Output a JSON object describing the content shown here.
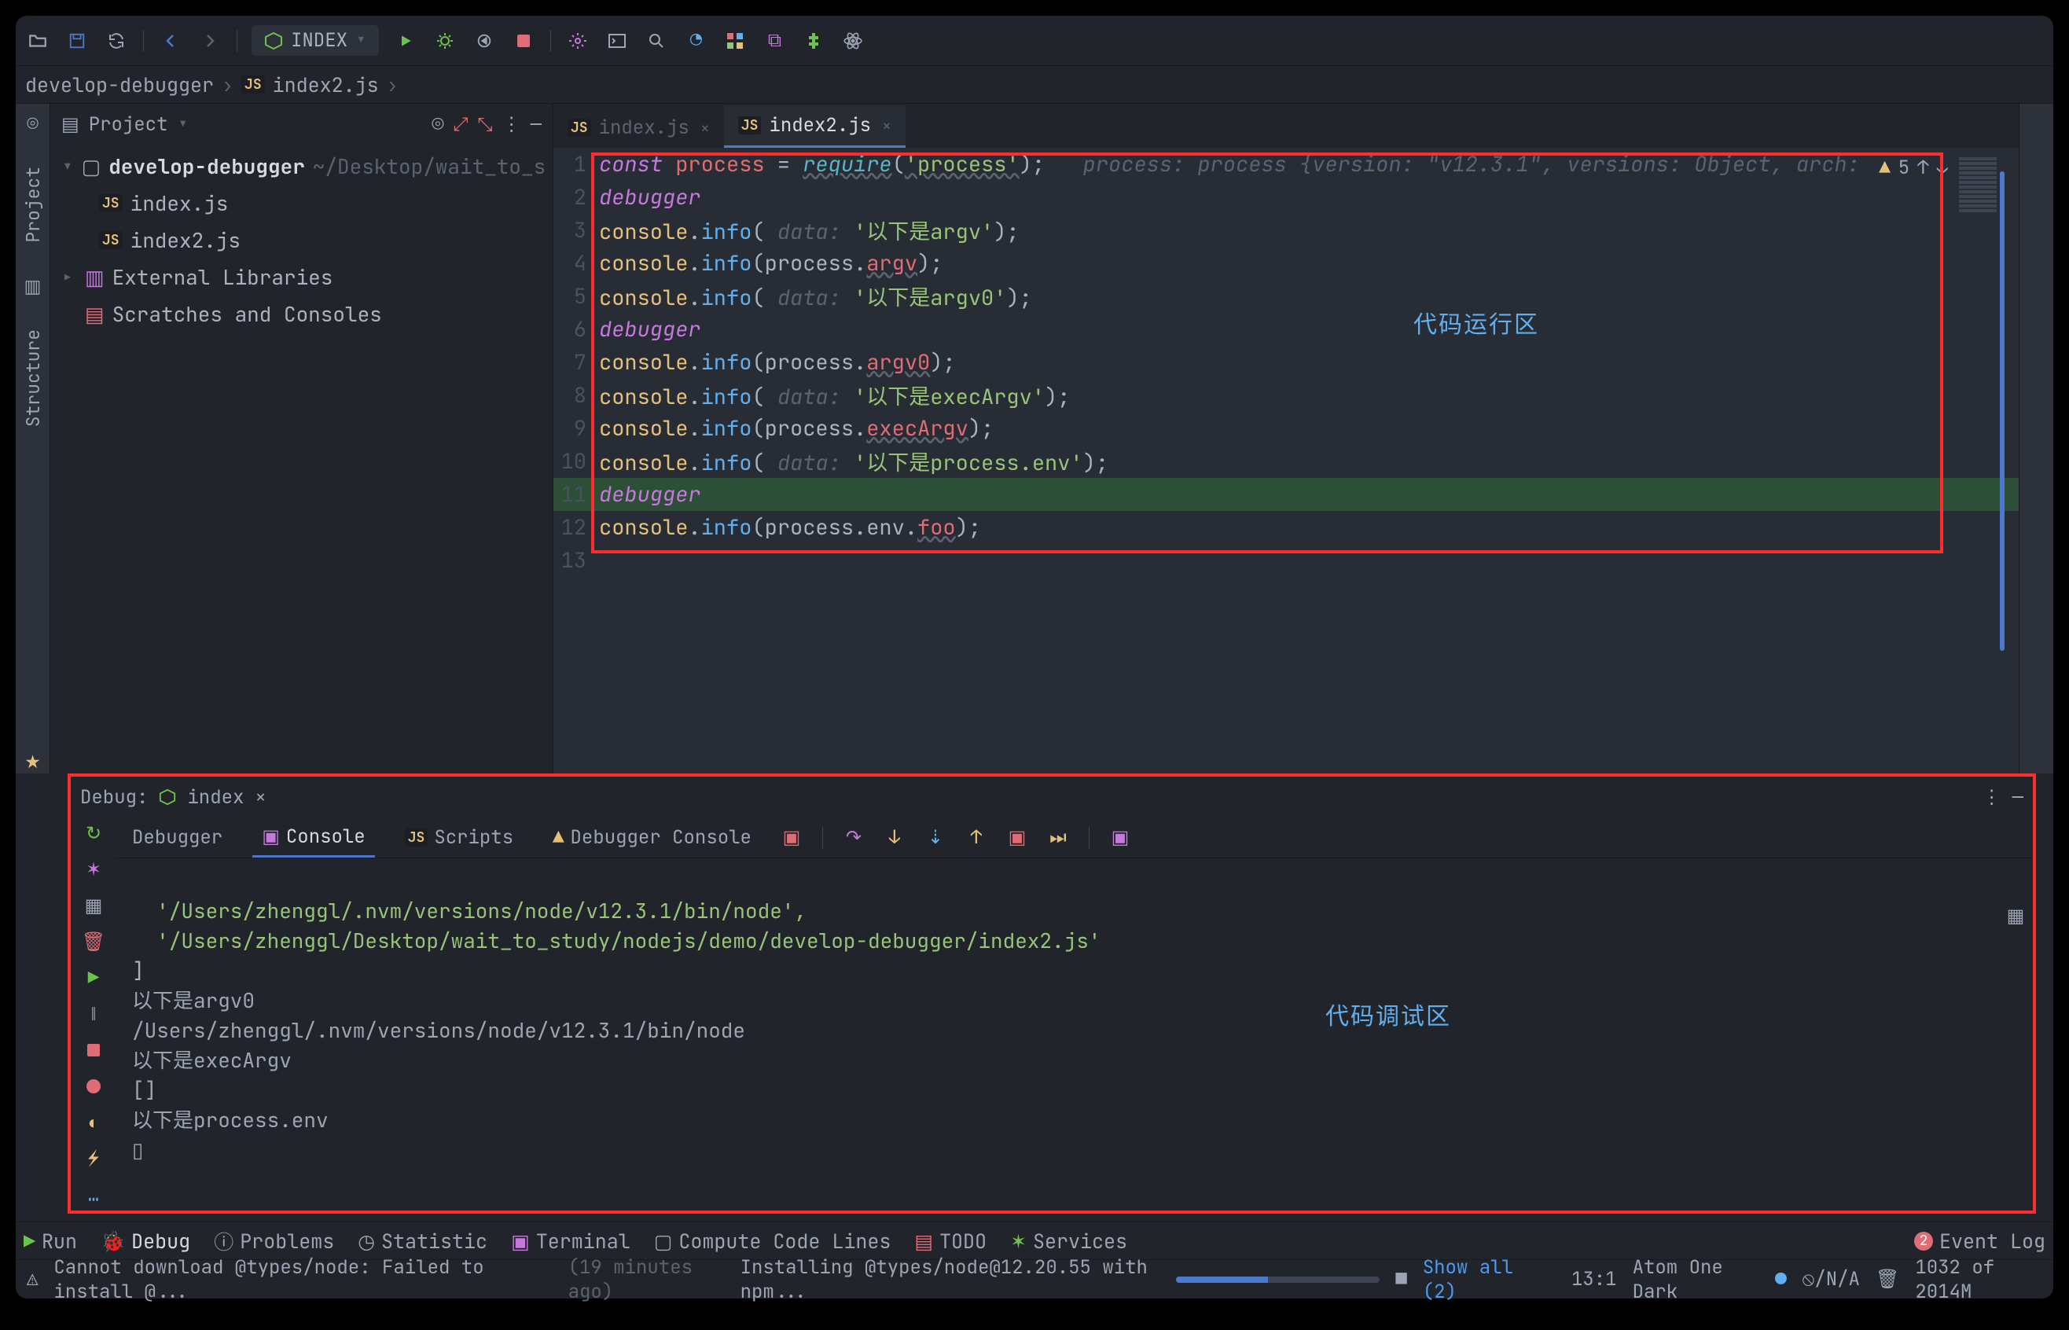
{
  "toolbar": {
    "run_config": "INDEX"
  },
  "breadcrumbs": {
    "project": "develop-debugger",
    "file": "index2.js"
  },
  "project_panel": {
    "title": "Project",
    "root": {
      "name": "develop-debugger",
      "path": "~/Desktop/wait_to_s"
    },
    "files": {
      "f1": "index.js",
      "f2": "index2.js"
    },
    "ext_libs": "External Libraries",
    "scratches": "Scratches and Consoles"
  },
  "left_gutter": {
    "project": "Project",
    "structure": "Structure"
  },
  "right_gutter": {
    "favorites": "Favorites"
  },
  "tabs": {
    "t1": "index.js",
    "t2": "index2.js"
  },
  "inspector": {
    "warn_count": "5"
  },
  "code_area_overlay": "代码运行区",
  "debug_area_overlay": "代码调试区",
  "code": {
    "l1": {
      "pre": "const ",
      "id": "process",
      "mid": " = ",
      "fn": "require",
      "open": "(",
      "str": "'process'",
      "close": ");",
      "hint": "   process: process {version: \"v12.3.1\", versions: Object, arch: "
    },
    "l2": "debugger",
    "l3": {
      "a": "console",
      "b": ".",
      "c": "info",
      "d": "( ",
      "hl": "data: ",
      "s": "'以下是argv'",
      "e": ");"
    },
    "l4": {
      "a": "console",
      "b": ".",
      "c": "info",
      "d": "(process.",
      "p": "argv",
      "e": ");"
    },
    "l5": {
      "a": "console",
      "b": ".",
      "c": "info",
      "d": "( ",
      "hl": "data: ",
      "s": "'以下是argv0'",
      "e": ");"
    },
    "l6": "debugger",
    "l7": {
      "a": "console",
      "b": ".",
      "c": "info",
      "d": "(process.",
      "p": "argv0",
      "e": ");"
    },
    "l8": {
      "a": "console",
      "b": ".",
      "c": "info",
      "d": "( ",
      "hl": "data: ",
      "s": "'以下是execArgv'",
      "e": ");"
    },
    "l9": {
      "a": "console",
      "b": ".",
      "c": "info",
      "d": "(process.",
      "p": "execArgv",
      "e": ");"
    },
    "l10": {
      "a": "console",
      "b": ".",
      "c": "info",
      "d": "( ",
      "hl": "data: ",
      "s": "'以下是process.env'",
      "e": ");"
    },
    "l11": "debugger",
    "l12": {
      "a": "console",
      "b": ".",
      "c": "info",
      "d": "(process.env.",
      "p": "foo",
      "e": ");"
    }
  },
  "debug": {
    "title": "Debug:",
    "config": "index",
    "tabs": {
      "debugger": "Debugger",
      "console": "Console",
      "scripts": "Scripts",
      "dbgcon": "Debugger Console"
    }
  },
  "console": {
    "l1": "  '/Users/zhenggl/.nvm/versions/node/v12.3.1/bin/node',",
    "l2": "  '/Users/zhenggl/Desktop/wait_to_study/nodejs/demo/develop-debugger/index2.js'",
    "l3": "]",
    "l4": "以下是argv0",
    "l5": "/Users/zhenggl/.nvm/versions/node/v12.3.1/bin/node",
    "l6": "以下是execArgv",
    "l7": "[]",
    "l8": "以下是process.env",
    "l9": "▯"
  },
  "bottom_tabs": {
    "run": "Run",
    "debug": "Debug",
    "problems": "Problems",
    "statistic": "Statistic",
    "terminal": "Terminal",
    "ccl": "Compute Code Lines",
    "todo": "TODO",
    "services": "Services",
    "event_log": "Event Log",
    "event_badge": "2"
  },
  "status": {
    "msg1": "Cannot download @types/node: Failed to install @...",
    "ago": "(19 minutes ago)",
    "msg2": "Installing @types/node@12.20.55 with npm...",
    "show_all": "Show all (2)",
    "pos": "13:1",
    "theme": "Atom One Dark",
    "power": "⦸/N/A",
    "mem": "1032 of 2014M"
  }
}
